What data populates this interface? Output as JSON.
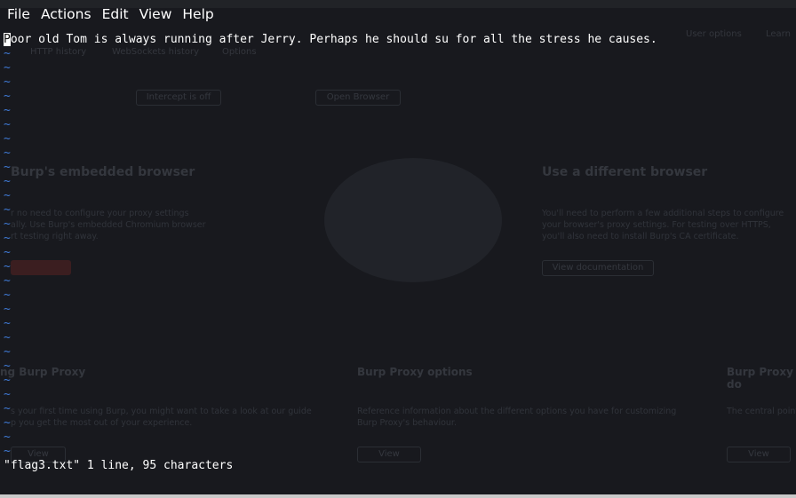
{
  "menu": {
    "items": [
      "File",
      "Actions",
      "Edit",
      "View",
      "Help"
    ]
  },
  "editor": {
    "first_char": "P",
    "line1_rest": "oor old Tom is always running after Jerry. Perhaps he should su for all the stress he causes.",
    "empty_line_marker": "~"
  },
  "status": {
    "message": "\"flag3.txt\" 1 line, 95 characters"
  },
  "colors": {
    "background": "#1a1b20",
    "text": "#ffffff",
    "tilde": "#3f79d4"
  },
  "background_app": {
    "tabs": [
      "HTTP history",
      "WebSockets history",
      "Options"
    ],
    "top_right": [
      "User options",
      "Learn"
    ],
    "buttons": [
      "Intercept is off",
      "Open Browser"
    ],
    "headings": [
      "Burp's embedded browser",
      "Use a different browser",
      "ng Burp Proxy",
      "Burp Proxy options",
      "Burp Proxy do"
    ],
    "paragraphs": [
      "r no need to configure your proxy settings\nally. Use Burp's embedded Chromium browser\nrt testing right away.",
      "You'll need to perform a few additional steps to configure\nyour browser's proxy settings. For testing over HTTPS,\nyou'll also need to install Burp's CA certificate.",
      "s your first time using Burp, you might want to take a look at our guide\np you get the most out of your experience.",
      "Reference information about the different options you have for customizing\nBurp Proxy's behaviour.",
      "The central point"
    ],
    "link_buttons": [
      "View documentation",
      "View",
      "View",
      "View"
    ]
  }
}
